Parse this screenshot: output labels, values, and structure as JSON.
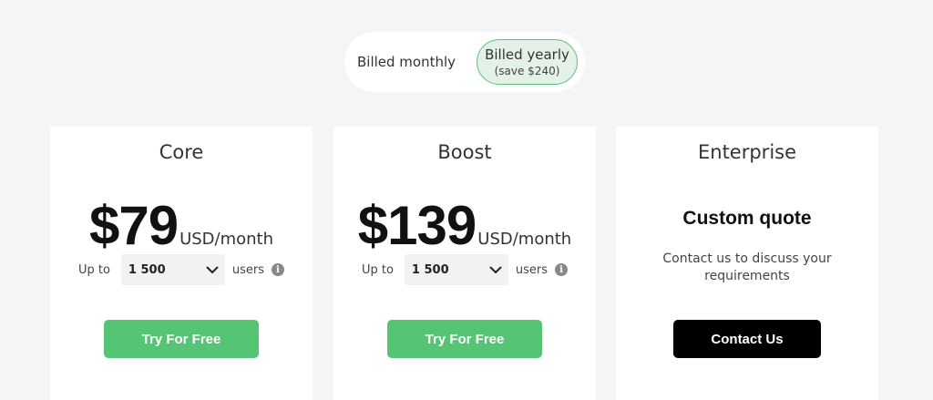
{
  "billing": {
    "monthly_label": "Billed monthly",
    "yearly_label": "Billed yearly",
    "yearly_savings": "(save $240)",
    "selected": "yearly"
  },
  "plans": [
    {
      "name": "Core",
      "price": "$79",
      "price_unit": "USD/month",
      "users_prefix": "Up to",
      "users_value": "1 500",
      "users_suffix": "users",
      "cta": "Try For Free"
    },
    {
      "name": "Boost",
      "price": "$139",
      "price_unit": "USD/month",
      "users_prefix": "Up to",
      "users_value": "1 500",
      "users_suffix": "users",
      "cta": "Try For Free"
    },
    {
      "name": "Enterprise",
      "headline": "Custom quote",
      "description": "Contact us to discuss your requirements",
      "cta": "Contact Us"
    }
  ],
  "icons": {
    "dropdown": "chevron-down-icon",
    "info": "info-icon"
  },
  "colors": {
    "accent_green": "#55c475",
    "contact_black": "#000000",
    "background": "#f4f5f7"
  }
}
